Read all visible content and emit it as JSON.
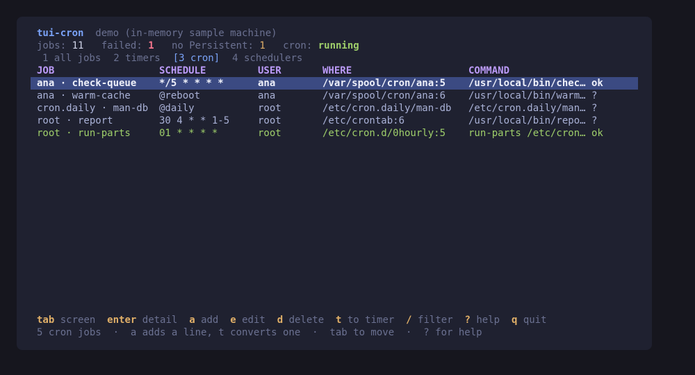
{
  "header": {
    "app_name": "tui-cron",
    "subtitle": "demo (in-memory sample machine)"
  },
  "stats": {
    "jobs_label": "jobs:",
    "jobs_value": "11",
    "failed_label": "failed:",
    "failed_value": "1",
    "nopersist_label": "no Persistent:",
    "nopersist_value": "1",
    "cron_label": "cron:",
    "cron_value": "running"
  },
  "tabs": [
    {
      "label": "1 all jobs",
      "active": false
    },
    {
      "label": "2 timers",
      "active": false
    },
    {
      "label": "[3 cron]",
      "active": true
    },
    {
      "label": "4 schedulers",
      "active": false
    }
  ],
  "table": {
    "columns": [
      "JOB",
      "SCHEDULE",
      "USER",
      "WHERE",
      "COMMAND"
    ],
    "rows": [
      {
        "job": "ana · check-queue",
        "schedule": "*/5 * * * *",
        "user": "ana",
        "where": "/var/spool/cron/ana:5",
        "command": "/usr/local/bin/chec…",
        "status": "ok"
      },
      {
        "job": "ana · warm-cache",
        "schedule": "@reboot",
        "user": "ana",
        "where": "/var/spool/cron/ana:6",
        "command": "/usr/local/bin/warm…",
        "status": "?"
      },
      {
        "job": "cron.daily · man-db",
        "schedule": "@daily",
        "user": "root",
        "where": "/etc/cron.daily/man-db",
        "command": "/etc/cron.daily/man…",
        "status": "?"
      },
      {
        "job": "root · report",
        "schedule": "30 4 * * 1-5",
        "user": "root",
        "where": "/etc/crontab:6",
        "command": "/usr/local/bin/repo…",
        "status": "?"
      },
      {
        "job": "root · run-parts",
        "schedule": "01 * * * *",
        "user": "root",
        "where": "/etc/cron.d/0hourly:5",
        "command": "run-parts /etc/cron…",
        "status": "ok"
      }
    ]
  },
  "footer": {
    "keys": [
      {
        "key": "tab",
        "action": "screen"
      },
      {
        "key": "enter",
        "action": "detail"
      },
      {
        "key": "a",
        "action": "add"
      },
      {
        "key": "e",
        "action": "edit"
      },
      {
        "key": "d",
        "action": "delete"
      },
      {
        "key": "t",
        "action": "to timer"
      },
      {
        "key": "/",
        "action": "filter"
      },
      {
        "key": "?",
        "action": "help"
      },
      {
        "key": "q",
        "action": "quit"
      }
    ],
    "status_line": "5 cron jobs  ·  a adds a line, t converts one  ·  tab to move  ·  ? for help"
  }
}
